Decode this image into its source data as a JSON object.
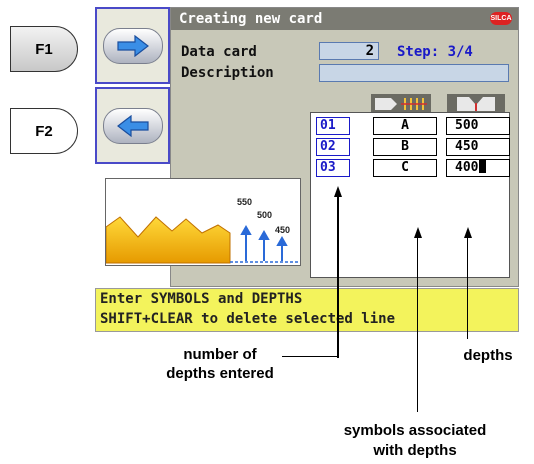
{
  "fkeys": {
    "f1": "F1",
    "f2": "F2"
  },
  "screen": {
    "title": "Creating new card",
    "logo": "SILCA",
    "data_card_label": "Data card",
    "data_card_value": "2",
    "step_label": "Step: 3/4",
    "description_label": "Description",
    "description_value": ""
  },
  "table": {
    "rows": [
      {
        "num": "01",
        "symbol": "A",
        "depth": "500"
      },
      {
        "num": "02",
        "symbol": "B",
        "depth": "450"
      },
      {
        "num": "03",
        "symbol": "C",
        "depth": "400"
      }
    ]
  },
  "preview": {
    "labels": [
      "550",
      "500",
      "450"
    ]
  },
  "message": {
    "line1": "Enter SYMBOLS and DEPTHS",
    "line2": "SHIFT+CLEAR to delete selected line"
  },
  "callouts": {
    "depths_entered": "number of\ndepths entered",
    "depths": "depths",
    "symbols": "symbols associated\nwith depths"
  },
  "colors": {
    "accent_blue": "#1a1ac8",
    "message_bg": "#f3f35c",
    "title_bg": "#7b7b73"
  }
}
